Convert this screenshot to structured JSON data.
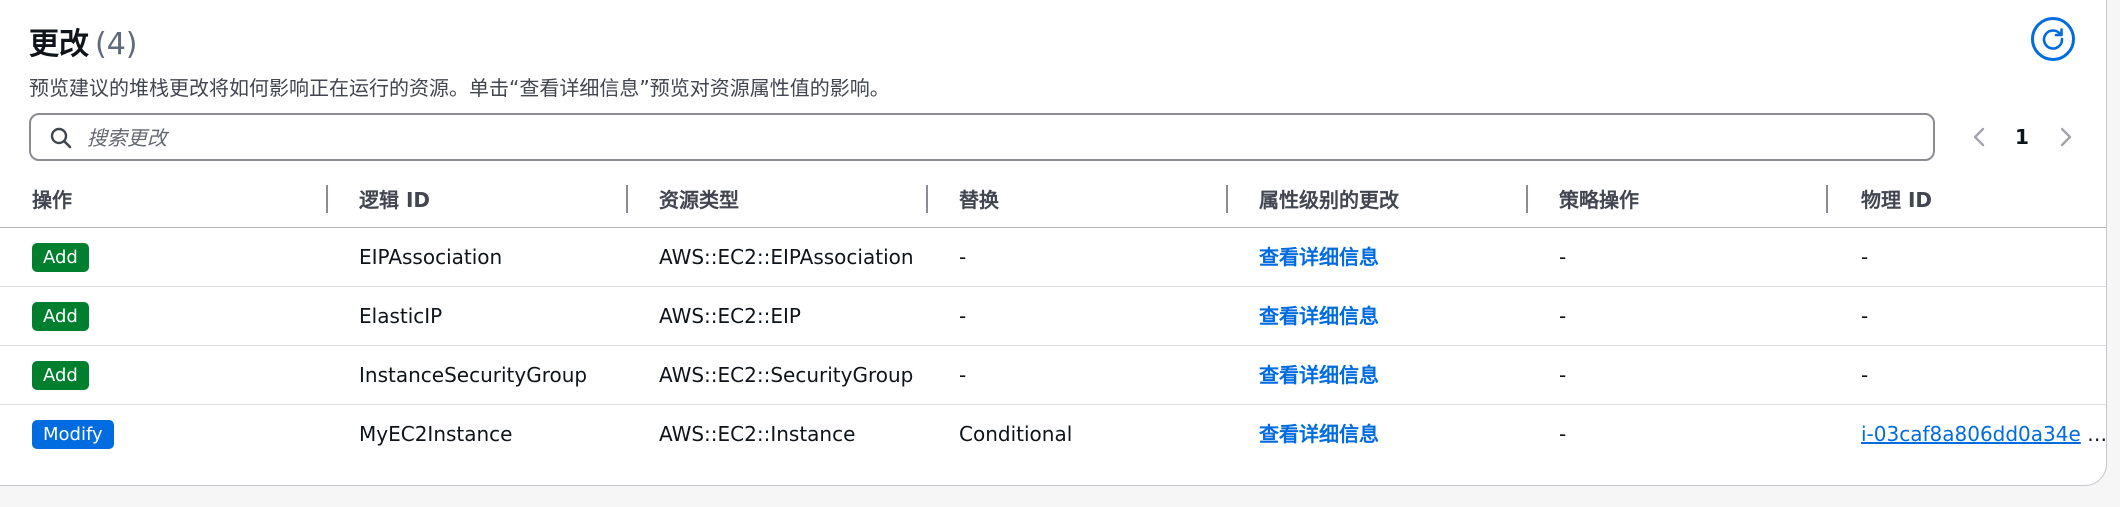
{
  "header": {
    "title": "更改",
    "count": "(4)",
    "description": "预览建议的堆栈更改将如何影响正在运行的资源。单击“查看详细信息”预览对资源属性值的影响。"
  },
  "search": {
    "placeholder": "搜索更改",
    "value": ""
  },
  "pagination": {
    "current_page": "1"
  },
  "table": {
    "columns": [
      "操作",
      "逻辑 ID",
      "资源类型",
      "替换",
      "属性级别的更改",
      "策略操作",
      "物理 ID"
    ],
    "rows": [
      {
        "action": "Add",
        "logical_id": "EIPAssociation",
        "resource_type": "AWS::EC2::EIPAssociation",
        "replacement": "-",
        "property_changes": "查看详细信息",
        "policy_action": "-",
        "physical_id": "-"
      },
      {
        "action": "Add",
        "logical_id": "ElasticIP",
        "resource_type": "AWS::EC2::EIP",
        "replacement": "-",
        "property_changes": "查看详细信息",
        "policy_action": "-",
        "physical_id": "-"
      },
      {
        "action": "Add",
        "logical_id": "InstanceSecurityGroup",
        "resource_type": "AWS::EC2::SecurityGroup",
        "replacement": "-",
        "property_changes": "查看详细信息",
        "policy_action": "-",
        "physical_id": "-"
      },
      {
        "action": "Modify",
        "logical_id": "MyEC2Instance",
        "resource_type": "AWS::EC2::Instance",
        "replacement": "Conditional",
        "property_changes": "查看详细信息",
        "policy_action": "-",
        "physical_id": "i-03caf8a806dd0a34e",
        "physical_id_suffix": "…"
      }
    ]
  },
  "colors": {
    "add_badge": "#00802f",
    "modify_badge": "#006ce0",
    "link": "#006ce0",
    "text": "#0f141a",
    "secondary_text": "#424650"
  },
  "icons": [
    "refresh-icon",
    "search-icon",
    "chevron-left-icon",
    "chevron-right-icon"
  ]
}
